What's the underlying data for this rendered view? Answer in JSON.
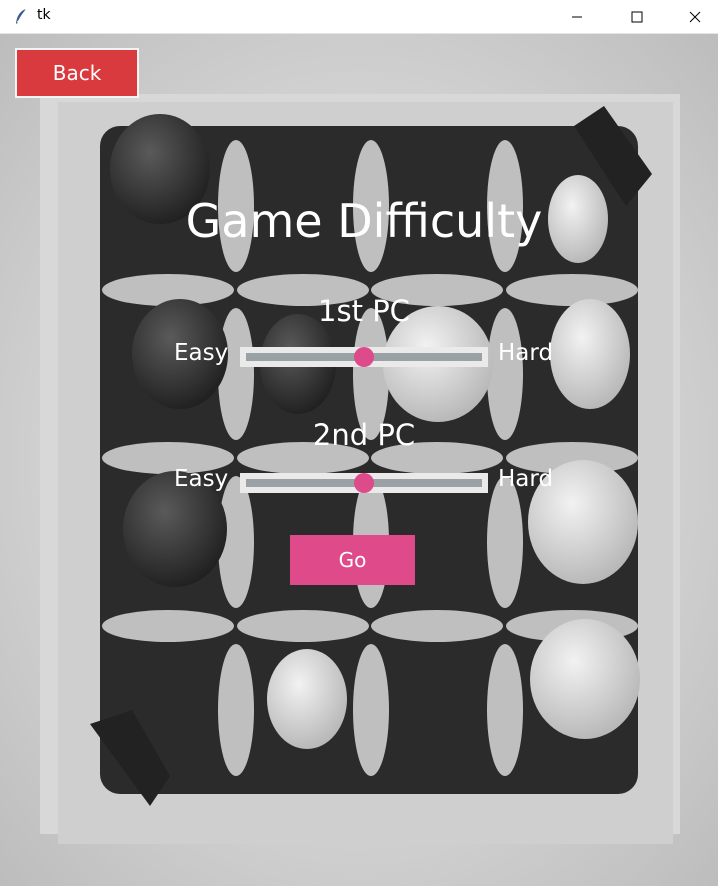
{
  "window": {
    "title": "tk",
    "minimize_symbol": "—",
    "maximize_symbol": "☐",
    "close_symbol": "✕"
  },
  "back_button": {
    "label": "Back"
  },
  "heading": "Game Difficulty",
  "sliders": [
    {
      "label": "1st PC",
      "min_label": "Easy",
      "max_label": "Hard",
      "value": 0.5
    },
    {
      "label": "2nd PC",
      "min_label": "Easy",
      "max_label": "Hard",
      "value": 0.5
    }
  ],
  "go_button": {
    "label": "Go"
  },
  "colors": {
    "back_button": "#d93a3e",
    "go_button": "#df4a8a",
    "slider_thumb": "#de4b8a",
    "slider_track": "#9aa2a6"
  }
}
